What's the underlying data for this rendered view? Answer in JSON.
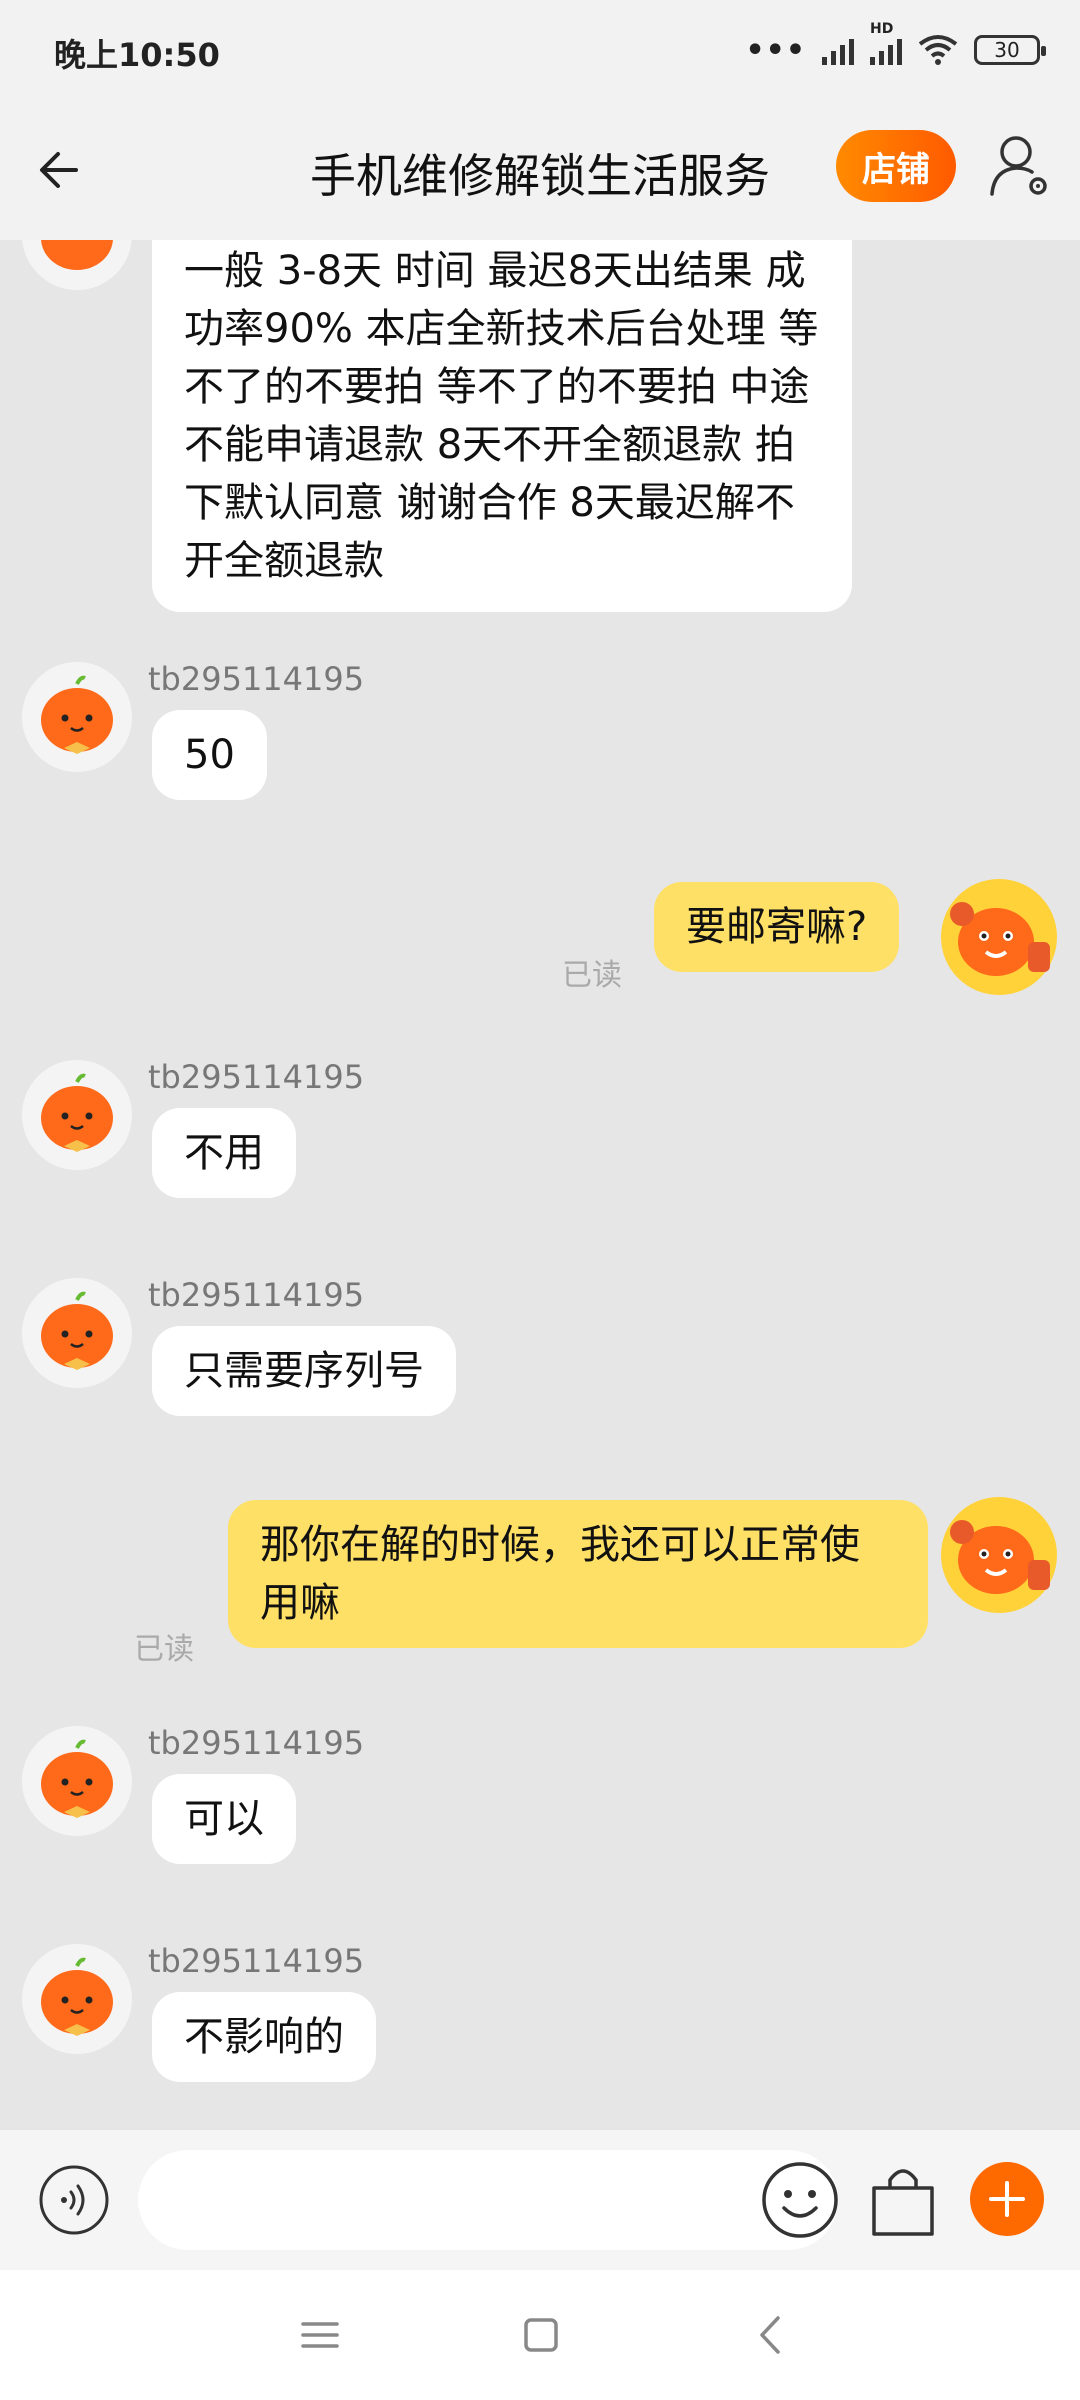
{
  "status_bar": {
    "time": "晚上10:50",
    "network_label": "HD",
    "battery": "30"
  },
  "header": {
    "title": "手机维修解锁生活服务",
    "shop_label": "店铺"
  },
  "messages": [
    {
      "type": "received",
      "sender": "",
      "text": "一般 3-8天 时间  最迟8天出结果  成功率90%  本店全新技术后台处理 等不了的不要拍 等不了的不要拍 中途不能申请退款 8天不开全额退款 拍下默认同意 谢谢合作 8天最迟解不开全额退款"
    },
    {
      "type": "received",
      "sender": "tb295114195",
      "text": "50"
    },
    {
      "type": "sent",
      "text": "要邮寄嘛?",
      "status": "已读"
    },
    {
      "type": "received",
      "sender": "tb295114195",
      "text": "不用"
    },
    {
      "type": "received",
      "sender": "tb295114195",
      "text": "只需要序列号"
    },
    {
      "type": "sent",
      "text": "那你在解的时候，我还可以正常使用嘛",
      "status": "已读"
    },
    {
      "type": "received",
      "sender": "tb295114195",
      "text": "可以"
    },
    {
      "type": "received",
      "sender": "tb295114195",
      "text": "不影响的"
    }
  ],
  "input_bar": {
    "placeholder": "",
    "value": ""
  },
  "icons": {
    "back": "arrow-left-icon",
    "user_settings": "user-settings-icon",
    "voice": "voice-icon",
    "emoji": "emoji-icon",
    "bag": "shopping-bag-icon",
    "plus": "plus-icon",
    "nav_menu": "menu-icon",
    "nav_home": "home-icon",
    "nav_back": "back-icon"
  },
  "colors": {
    "accent": "#ff6a00",
    "sent_bubble": "#ffe066",
    "chat_background": "#e6e6e6"
  }
}
